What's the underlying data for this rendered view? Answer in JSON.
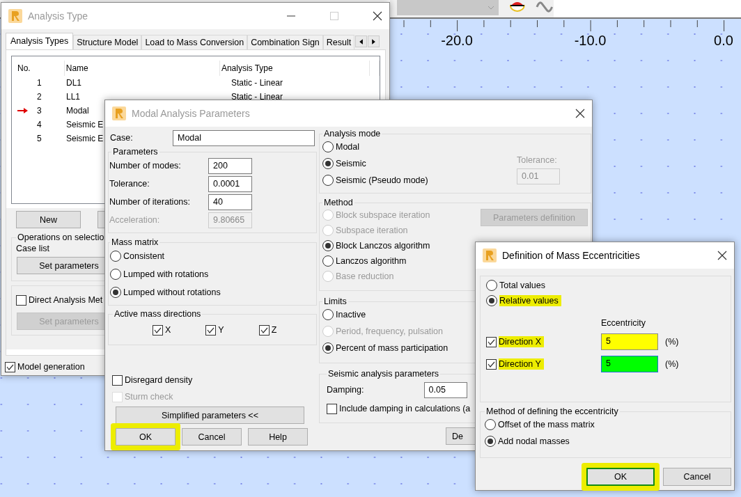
{
  "ruler": {
    "labels": [
      "-20.0",
      "-10.0",
      "0.0"
    ]
  },
  "analysis_window": {
    "title": "Analysis Type",
    "active": false,
    "tabs": [
      {
        "label": "Analysis Types",
        "selected": true
      },
      {
        "label": "Structure Model",
        "selected": false
      },
      {
        "label": "Load to Mass Conversion",
        "selected": false
      },
      {
        "label": "Combination Sign",
        "selected": false
      },
      {
        "label": "Result",
        "selected": false
      }
    ],
    "table": {
      "columns": [
        "No.",
        "Name",
        "Analysis Type"
      ],
      "rows": [
        {
          "no": "1",
          "name": "DL1",
          "type": "Static - Linear",
          "current": false
        },
        {
          "no": "2",
          "name": "LL1",
          "type": "Static - Linear",
          "current": false
        },
        {
          "no": "3",
          "name": "Modal",
          "current": true
        },
        {
          "no": "4",
          "name": "Seismic E",
          "current": false
        },
        {
          "no": "5",
          "name": "Seismic E",
          "current": false
        }
      ]
    },
    "new_button": "New",
    "operations": {
      "title": "Operations on selectio",
      "label": "Case list",
      "button": "Set parameters"
    },
    "direct_analysis": {
      "checkbox": {
        "label": "Direct Analysis Met",
        "checked": false
      },
      "button": {
        "label": "Set parameters",
        "disabled": true
      }
    },
    "model_generation": {
      "label": "Model generation",
      "checked": true
    }
  },
  "modal_window": {
    "title": "Modal Analysis Parameters",
    "active": false,
    "case": {
      "label": "Case:",
      "value": "Modal"
    },
    "parameters": {
      "title": "Parameters",
      "fields": [
        {
          "label": "Number of modes:",
          "value": "200",
          "disabled": false
        },
        {
          "label": "Tolerance:",
          "value": "0.0001",
          "disabled": false
        },
        {
          "label": "Number of iterations:",
          "value": "40",
          "disabled": false
        },
        {
          "label": "Acceleration:",
          "value": "9.80665",
          "disabled": true
        }
      ]
    },
    "mass_matrix": {
      "title": "Mass matrix",
      "options": [
        {
          "label": "Consistent",
          "selected": false
        },
        {
          "label": "Lumped with rotations",
          "selected": false
        },
        {
          "label": "Lumped without rotations",
          "selected": true
        }
      ]
    },
    "mass_directions": {
      "title": "Active mass directions",
      "items": [
        {
          "label": "X",
          "checked": true
        },
        {
          "label": "Y",
          "checked": true
        },
        {
          "label": "Z",
          "checked": true
        }
      ]
    },
    "disregard_density": {
      "label": "Disregard density",
      "checked": false,
      "disabled": false
    },
    "sturm_check": {
      "label": "Sturm check",
      "checked": false,
      "disabled": true
    },
    "simplified_button": "Simplified parameters <<",
    "buttons": [
      {
        "label": "OK",
        "circled": true
      },
      {
        "label": "Cancel",
        "circled": false
      },
      {
        "label": "Help",
        "circled": false
      }
    ],
    "analysis_mode": {
      "title": "Analysis mode",
      "options": [
        {
          "label": "Modal",
          "selected": false
        },
        {
          "label": "Seismic",
          "selected": true
        },
        {
          "label": "Seismic (Pseudo mode)",
          "selected": false
        }
      ],
      "tolerance": {
        "label": "Tolerance:",
        "value": "0.01",
        "disabled": true
      }
    },
    "method": {
      "title": "Method",
      "options": [
        {
          "label": "Block subspace iteration",
          "selected": false,
          "disabled": true
        },
        {
          "label": "Subspace iteration",
          "selected": false,
          "disabled": true
        },
        {
          "label": "Block Lanczos algorithm",
          "selected": true,
          "disabled": false
        },
        {
          "label": "Lanczos algorithm",
          "selected": false,
          "disabled": false
        },
        {
          "label": "Base reduction",
          "selected": false,
          "disabled": true
        }
      ],
      "button": {
        "label": "Parameters definition",
        "disabled": true
      }
    },
    "limits": {
      "title": "Limits",
      "options": [
        {
          "label": "Inactive",
          "selected": false,
          "disabled": false
        },
        {
          "label": "Period, frequency, pulsation",
          "selected": false,
          "disabled": true
        },
        {
          "label": "Percent of mass participation",
          "selected": true,
          "disabled": false
        }
      ]
    },
    "seismic": {
      "title": "Seismic analysis parameters",
      "damping": {
        "label": "Damping:",
        "value": "0.05"
      },
      "include_damping": {
        "label": "Include damping in calculations (a",
        "checked": false
      }
    },
    "partial_button": "De"
  },
  "ecc_window": {
    "title": "Definition of Mass Eccentricities",
    "active": true,
    "value_type": [
      {
        "label": "Total values",
        "selected": false,
        "highlighted": false
      },
      {
        "label": "Relative values",
        "selected": true,
        "highlighted": true
      }
    ],
    "eccentricity_heading": "Eccentricity",
    "directions": [
      {
        "label": "Direction X",
        "checked": true,
        "highlighted": true,
        "value": "5",
        "color": "#ffff00",
        "focused": false,
        "unit": "(%)"
      },
      {
        "label": "Direction Y",
        "checked": true,
        "highlighted": true,
        "value": "5",
        "color": "#00ff00",
        "focused": true,
        "unit": "(%)"
      }
    ],
    "method": {
      "title": "Method of defining the eccentricity",
      "options": [
        {
          "label": "Offset of the mass matrix",
          "selected": false
        },
        {
          "label": "Add nodal masses",
          "selected": true
        }
      ]
    },
    "buttons": [
      {
        "label": "OK",
        "default": true,
        "circled": true
      },
      {
        "label": "Cancel",
        "default": false,
        "circled": false
      }
    ]
  }
}
